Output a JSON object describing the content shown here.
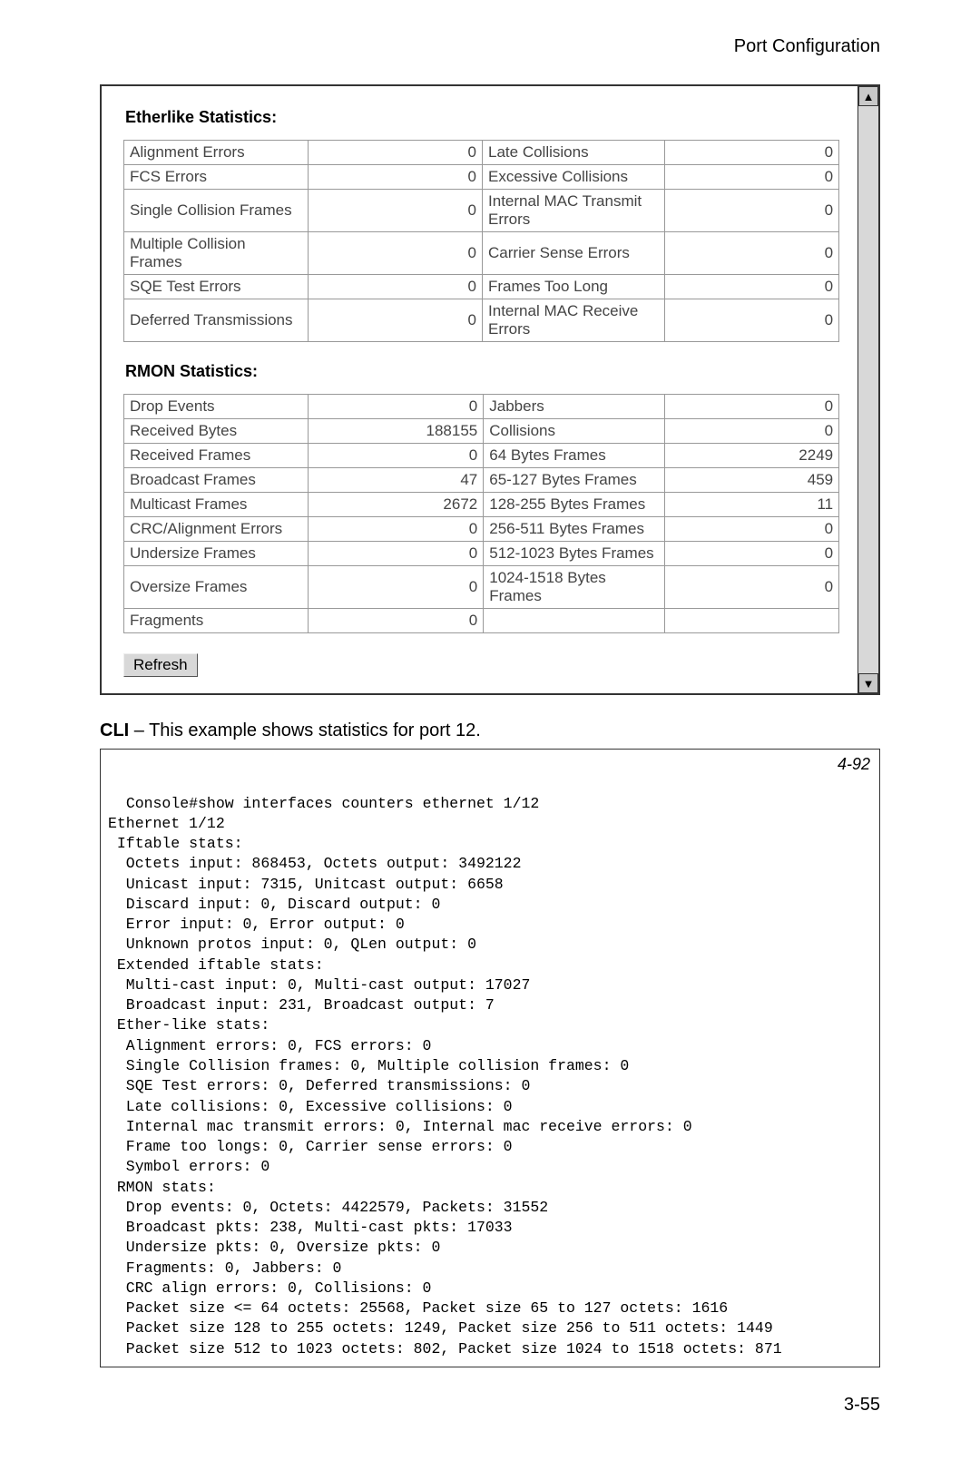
{
  "header": {
    "title": "Port Configuration"
  },
  "etherlike": {
    "title": "Etherlike Statistics:",
    "rows": [
      {
        "l1": "Alignment Errors",
        "v1": "0",
        "l2": "Late Collisions",
        "v2": "0"
      },
      {
        "l1": "FCS Errors",
        "v1": "0",
        "l2": "Excessive Collisions",
        "v2": "0"
      },
      {
        "l1": "Single Collision Frames",
        "v1": "0",
        "l2": "Internal MAC Transmit Errors",
        "v2": "0"
      },
      {
        "l1": "Multiple Collision Frames",
        "v1": "0",
        "l2": "Carrier Sense Errors",
        "v2": "0"
      },
      {
        "l1": "SQE Test Errors",
        "v1": "0",
        "l2": "Frames Too Long",
        "v2": "0"
      },
      {
        "l1": "Deferred Transmissions",
        "v1": "0",
        "l2": "Internal MAC Receive Errors",
        "v2": "0"
      }
    ]
  },
  "rmon": {
    "title": "RMON Statistics:",
    "rows": [
      {
        "l1": "Drop Events",
        "v1": "0",
        "l2": "Jabbers",
        "v2": "0"
      },
      {
        "l1": "Received Bytes",
        "v1": "188155",
        "l2": "Collisions",
        "v2": "0"
      },
      {
        "l1": "Received Frames",
        "v1": "0",
        "l2": "64 Bytes Frames",
        "v2": "2249"
      },
      {
        "l1": "Broadcast Frames",
        "v1": "47",
        "l2": "65-127 Bytes Frames",
        "v2": "459"
      },
      {
        "l1": "Multicast Frames",
        "v1": "2672",
        "l2": "128-255 Bytes Frames",
        "v2": "11"
      },
      {
        "l1": "CRC/Alignment Errors",
        "v1": "0",
        "l2": "256-511 Bytes Frames",
        "v2": "0"
      },
      {
        "l1": "Undersize Frames",
        "v1": "0",
        "l2": "512-1023 Bytes Frames",
        "v2": "0"
      },
      {
        "l1": "Oversize Frames",
        "v1": "0",
        "l2": "1024-1518 Bytes Frames",
        "v2": "0"
      },
      {
        "l1": "Fragments",
        "v1": "0",
        "l2": "",
        "v2": ""
      }
    ]
  },
  "refresh_label": "Refresh",
  "cli_caption_bold": "CLI",
  "cli_caption_rest": " – This example shows statistics for port 12.",
  "cli_ref": "4-92",
  "cli_text": "Console#show interfaces counters ethernet 1/12\nEthernet 1/12\n Iftable stats:\n  Octets input: 868453, Octets output: 3492122\n  Unicast input: 7315, Unitcast output: 6658\n  Discard input: 0, Discard output: 0\n  Error input: 0, Error output: 0\n  Unknown protos input: 0, QLen output: 0\n Extended iftable stats:\n  Multi-cast input: 0, Multi-cast output: 17027\n  Broadcast input: 231, Broadcast output: 7\n Ether-like stats:\n  Alignment errors: 0, FCS errors: 0\n  Single Collision frames: 0, Multiple collision frames: 0\n  SQE Test errors: 0, Deferred transmissions: 0\n  Late collisions: 0, Excessive collisions: 0\n  Internal mac transmit errors: 0, Internal mac receive errors: 0\n  Frame too longs: 0, Carrier sense errors: 0\n  Symbol errors: 0\n RMON stats:\n  Drop events: 0, Octets: 4422579, Packets: 31552\n  Broadcast pkts: 238, Multi-cast pkts: 17033\n  Undersize pkts: 0, Oversize pkts: 0\n  Fragments: 0, Jabbers: 0\n  CRC align errors: 0, Collisions: 0\n  Packet size <= 64 octets: 25568, Packet size 65 to 127 octets: 1616\n  Packet size 128 to 255 octets: 1249, Packet size 256 to 511 octets: 1449\n  Packet size 512 to 1023 octets: 802, Packet size 1024 to 1518 octets: 871",
  "page_number": "3-55"
}
